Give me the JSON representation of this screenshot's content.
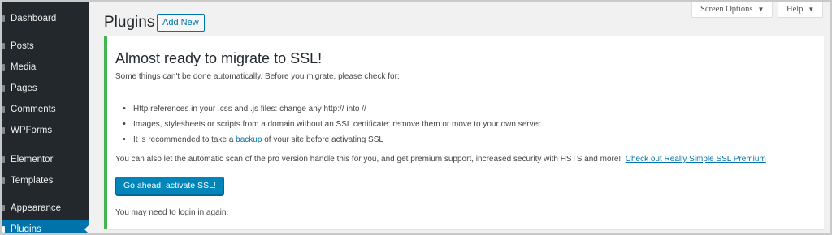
{
  "sidebar": {
    "items": [
      {
        "label": "Dashboard"
      },
      {
        "label": "Posts"
      },
      {
        "label": "Media"
      },
      {
        "label": "Pages"
      },
      {
        "label": "Comments"
      },
      {
        "label": "WPForms"
      },
      {
        "label": "Elementor"
      },
      {
        "label": "Templates"
      },
      {
        "label": "Appearance"
      },
      {
        "label": "Plugins",
        "active": true
      }
    ]
  },
  "header": {
    "title": "Plugins",
    "add_new": "Add New",
    "screen_options": "Screen Options",
    "help": "Help",
    "caret": "▼"
  },
  "notice": {
    "title": "Almost ready to migrate to SSL!",
    "intro": "Some things can't be done automatically. Before you migrate, please check for:",
    "checklist": {
      "item1": "Http references in your .css and .js files: change any http:// into //",
      "item2": "Images, stylesheets or scripts from a domain without an SSL certificate: remove them or move to your own server.",
      "item3_before": "It is recommended to take a ",
      "item3_link": "backup",
      "item3_after": " of your site before activating SSL"
    },
    "premium_text": "You can also let the automatic scan of the pro version handle this for you, and get premium support, increased security with HSTS and more!",
    "premium_link": "Check out Really Simple SSL Premium",
    "activate_button": "Go ahead, activate SSL!",
    "login_note": "You may need to login in again."
  },
  "colors": {
    "sidebar_bg": "#23282d",
    "active_menu": "#0073aa",
    "notice_border": "#46b450",
    "primary_button": "#0085ba",
    "link": "#0073aa"
  }
}
